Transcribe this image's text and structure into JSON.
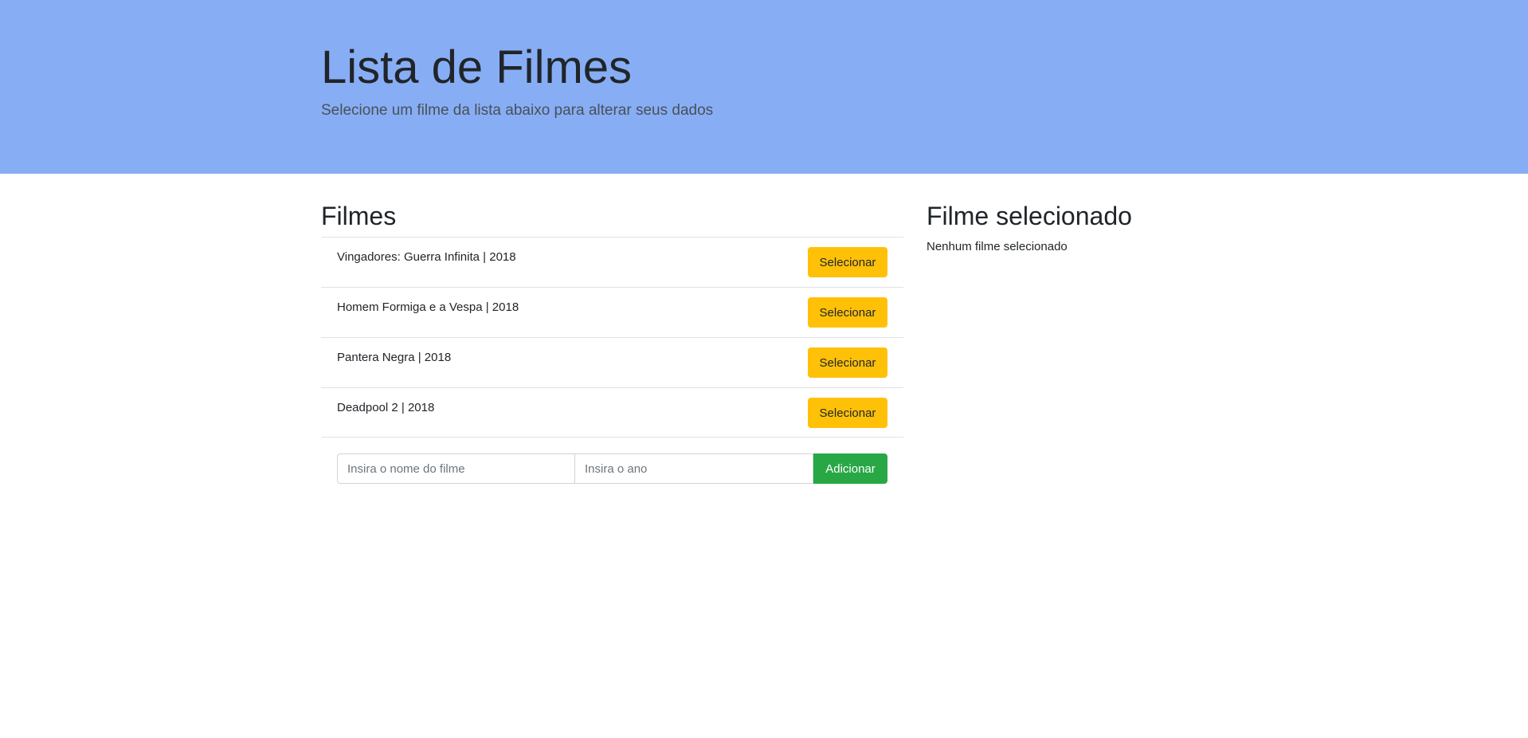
{
  "header": {
    "title": "Lista de Filmes",
    "subtitle": "Selecione um filme da lista abaixo para alterar seus dados"
  },
  "films_section": {
    "title": "Filmes",
    "items": [
      {
        "label": "Vingadores: Guerra Infinita | 2018",
        "button": "Selecionar"
      },
      {
        "label": "Homem Formiga e a Vespa | 2018",
        "button": "Selecionar"
      },
      {
        "label": "Pantera Negra | 2018",
        "button": "Selecionar"
      },
      {
        "label": "Deadpool 2 | 2018",
        "button": "Selecionar"
      }
    ]
  },
  "add_form": {
    "name_value": "",
    "name_placeholder": "Insira o nome do filme",
    "year_value": "",
    "year_placeholder": "Insira o ano",
    "add_label": "Adicionar"
  },
  "selected_section": {
    "title": "Filme selecionado",
    "empty_text": "Nenhum filme selecionado"
  },
  "colors": {
    "header_bg": "#87aef5",
    "select_button": "#ffc107",
    "add_button": "#28a745"
  }
}
